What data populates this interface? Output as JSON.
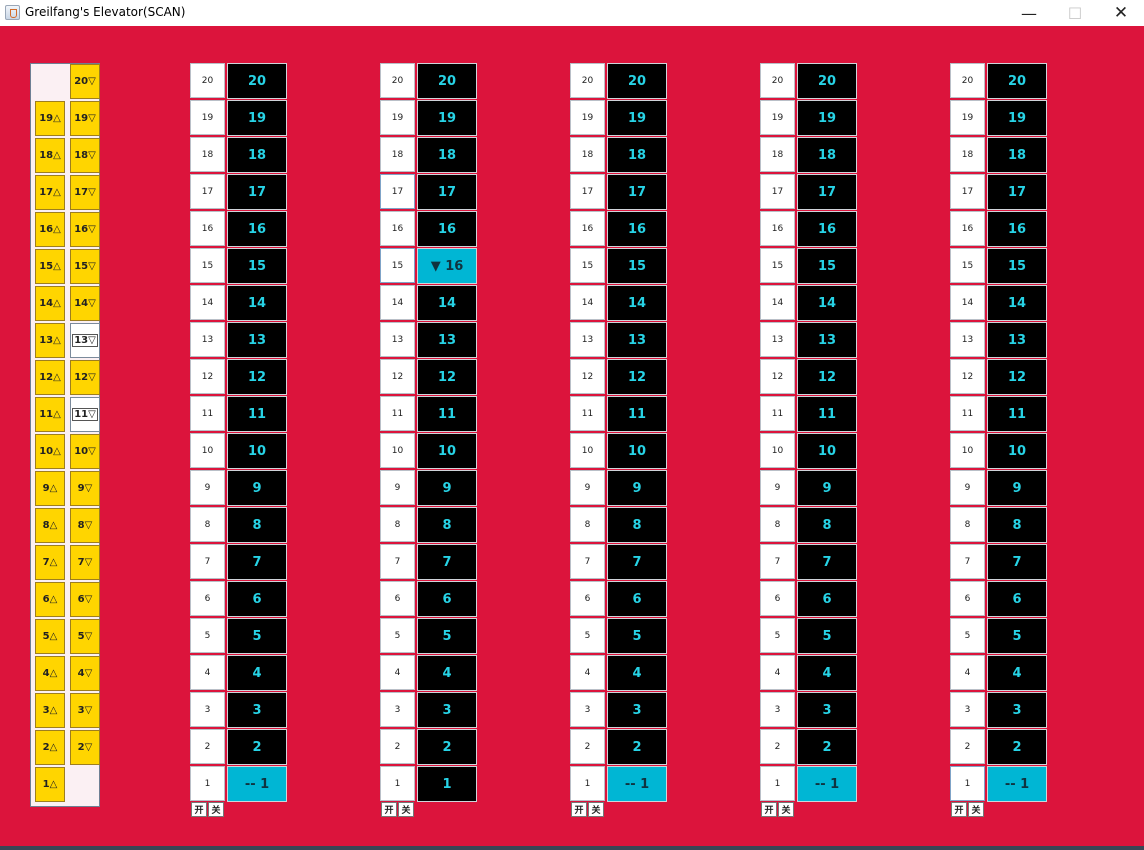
{
  "window": {
    "title": "Greilfang's Elevator(SCAN)",
    "minimize_glyph": "—",
    "maximize_glyph": "☐",
    "close_glyph": "✕",
    "app_icon": "java-coffee-icon"
  },
  "colors": {
    "background": "#dc143c",
    "hall_button": "#ffd500",
    "shaft": "#000000",
    "floor_text": "#27d3e6",
    "car": "#00b6d4"
  },
  "floors": [
    "20",
    "19",
    "18",
    "17",
    "16",
    "15",
    "14",
    "13",
    "12",
    "11",
    "10",
    "9",
    "8",
    "7",
    "6",
    "5",
    "4",
    "3",
    "2",
    "1"
  ],
  "hall_calls": {
    "up_labels": [
      "19△",
      "18△",
      "17△",
      "16△",
      "15△",
      "14△",
      "13△",
      "12△",
      "11△",
      "10△",
      "9△",
      "8△",
      "7△",
      "6△",
      "5△",
      "4△",
      "3△",
      "2△",
      "1△"
    ],
    "down_labels": [
      "20▽",
      "19▽",
      "18▽",
      "17▽",
      "16▽",
      "15▽",
      "14▽",
      "13▽",
      "12▽",
      "11▽",
      "10▽",
      "9▽",
      "8▽",
      "7▽",
      "6▽",
      "5▽",
      "4▽",
      "3▽",
      "2▽"
    ],
    "down_lit": [
      "13",
      "11"
    ]
  },
  "elevators": [
    {
      "id": 1,
      "car_floor": "1",
      "car_label": "-- 1",
      "lit_buttons": [],
      "open_label": "开",
      "close_label": "关"
    },
    {
      "id": 2,
      "car_floor": "15",
      "car_label": "▼ 16",
      "lit_buttons": [
        "17",
        "15"
      ],
      "open_label": "开",
      "close_label": "关"
    },
    {
      "id": 3,
      "car_floor": "1",
      "car_label": "-- 1",
      "lit_buttons": [],
      "open_label": "开",
      "close_label": "关"
    },
    {
      "id": 4,
      "car_floor": "1",
      "car_label": "-- 1",
      "lit_buttons": [],
      "open_label": "开",
      "close_label": "关"
    },
    {
      "id": 5,
      "car_floor": "1",
      "car_label": "-- 1",
      "lit_buttons": [
        "1"
      ],
      "open_label": "开",
      "close_label": "关"
    }
  ]
}
